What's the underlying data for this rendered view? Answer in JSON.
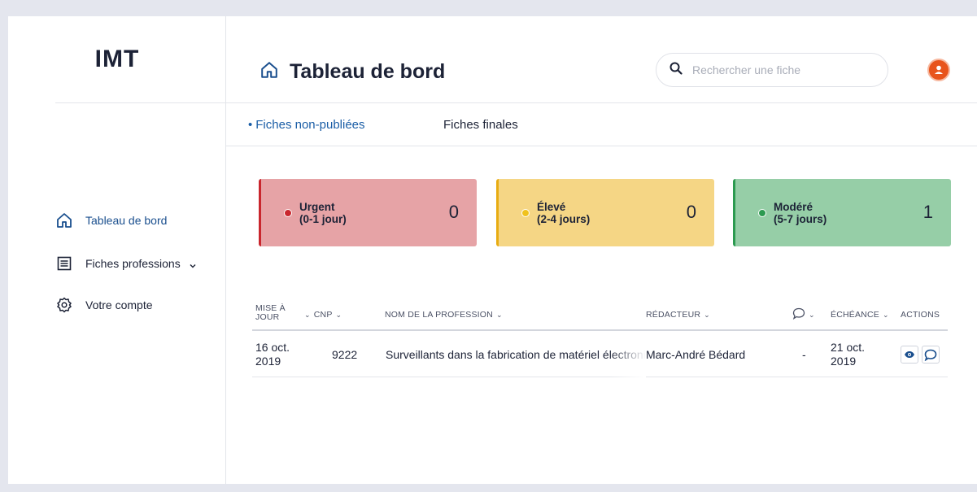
{
  "app": {
    "logo": "IMT"
  },
  "sidebar": {
    "items": [
      {
        "label": "Tableau de bord",
        "icon": "home-icon",
        "active": true
      },
      {
        "label": "Fiches professions",
        "icon": "list-icon",
        "active": false
      },
      {
        "label": "Votre compte",
        "icon": "gear-icon",
        "active": false
      }
    ]
  },
  "header": {
    "title": "Tableau de bord",
    "search_placeholder": "Rechercher une fiche"
  },
  "tabs": [
    {
      "label": "Fiches non-publiées",
      "active": true
    },
    {
      "label": "Fiches finales",
      "active": false
    }
  ],
  "priorities": [
    {
      "label": "Urgent",
      "range": "(0-1 jour)",
      "count": "0",
      "bg": "#e6a3a6",
      "accent": "#c9262d",
      "dot": "#c9262d"
    },
    {
      "label": "Élevé",
      "range": "(2-4 jours)",
      "count": "0",
      "bg": "#f5d685",
      "accent": "#e8ac12",
      "dot": "#f0c21e"
    },
    {
      "label": "Modéré",
      "range": "(5-7 jours)",
      "count": "1",
      "bg": "#96cea7",
      "accent": "#2c9a50",
      "dot": "#2c9a50"
    }
  ],
  "table": {
    "columns": [
      {
        "label_line1": "MISE À",
        "label_line2": "JOUR"
      },
      {
        "label": "CNP"
      },
      {
        "label": "NOM DE LA PROFESSION"
      },
      {
        "label": "RÉDACTEUR"
      },
      {
        "label": ""
      },
      {
        "label": "ÉCHÉANCE"
      },
      {
        "label": "ACTIONS"
      }
    ],
    "rows": [
      {
        "updated_line1": "16 oct.",
        "updated_line2": "2019",
        "cnp": "9222",
        "profession": "Surveillants dans la fabrication de matériel électronique",
        "editor": "Marc-André Bédard",
        "comments": "-",
        "due_line1": "21 oct.",
        "due_line2": "2019"
      }
    ]
  },
  "colors": {
    "primary": "#1a5da6",
    "avatar": "#e8541c"
  }
}
